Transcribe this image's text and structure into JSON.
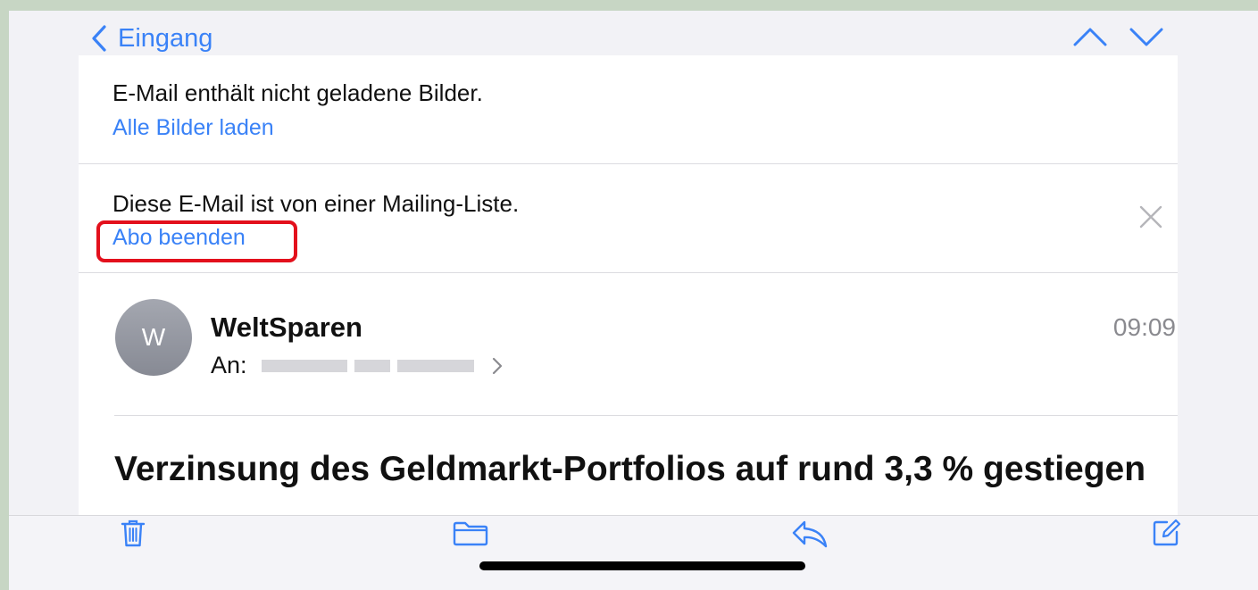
{
  "nav": {
    "back_label": "Eingang"
  },
  "notices": {
    "images_message": "E-Mail enthält nicht geladene Bilder.",
    "load_images_link": "Alle Bilder laden",
    "mailing_list_message": "Diese E-Mail ist von einer Mailing-Liste.",
    "unsubscribe_link": "Abo beenden"
  },
  "email": {
    "avatar_initial": "W",
    "sender": "WeltSparen",
    "time": "09:09",
    "to_label": "An:",
    "subject": "Verzinsung des Geldmarkt-Portfolios auf rund 3,3 % gestiegen"
  },
  "icons": {
    "back": "chevron-left-icon",
    "prev": "chevron-up-icon",
    "next": "chevron-down-icon",
    "dismiss": "close-icon",
    "trash": "trash-icon",
    "folder": "folder-icon",
    "reply": "reply-icon",
    "compose": "compose-icon"
  },
  "colors": {
    "accent": "#3a82f7",
    "highlight": "#e3101c"
  }
}
